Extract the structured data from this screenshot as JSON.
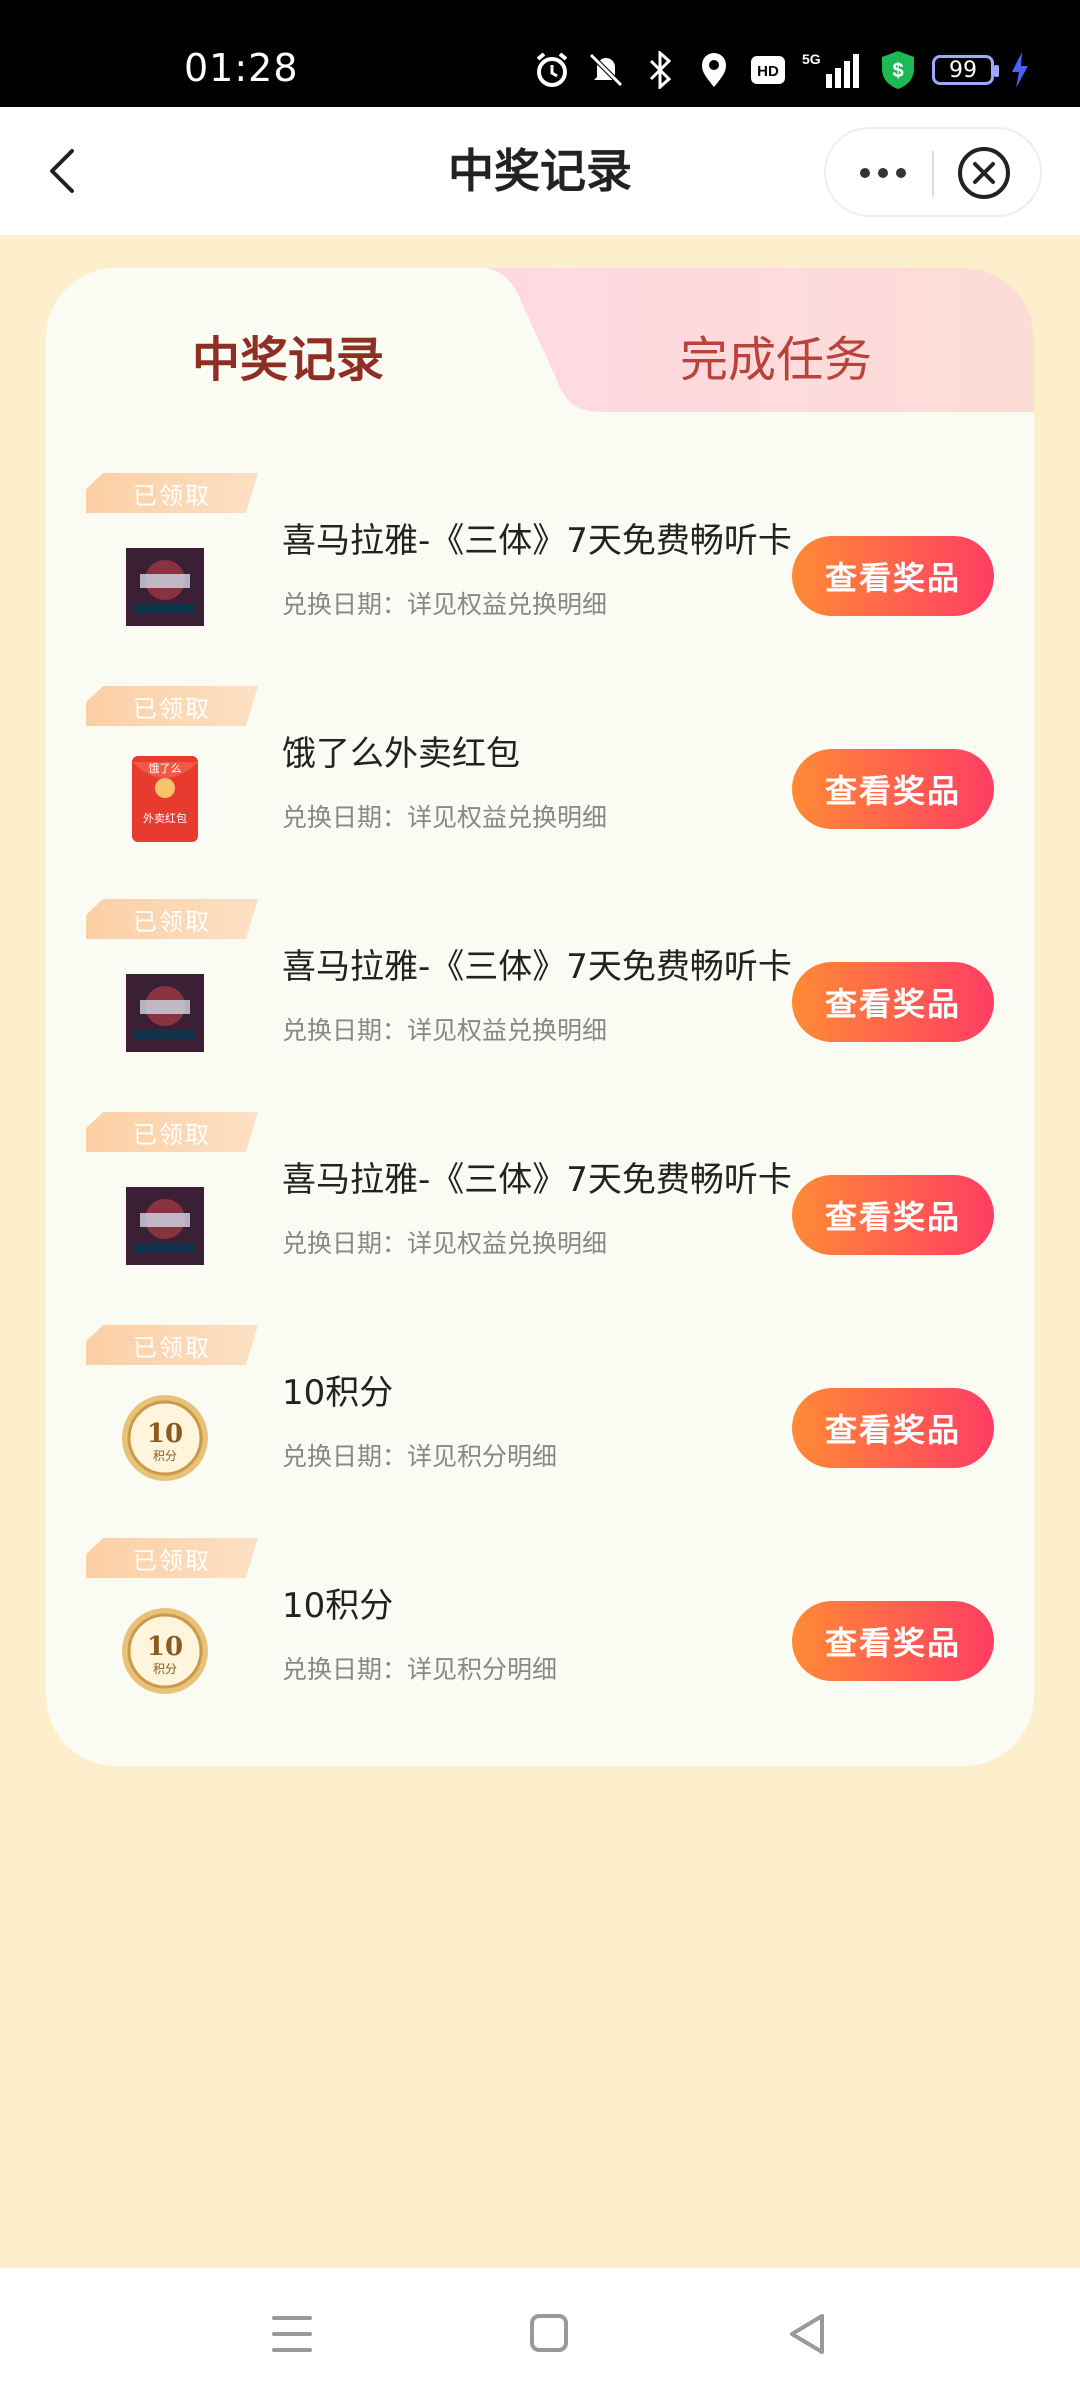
{
  "status_bar": {
    "time": "01:28",
    "network": "5G",
    "battery": "99",
    "icons": [
      "alarm-icon",
      "mute-icon",
      "bluetooth-icon",
      "location-icon",
      "hd-icon",
      "signal-icon",
      "shield-dollar-icon",
      "battery-icon",
      "charging-icon"
    ]
  },
  "header": {
    "title": "中奖记录",
    "back_icon": "chevron-left-icon",
    "more_icon": "more-icon",
    "close_icon": "close-circle-icon"
  },
  "tabs": [
    {
      "label": "中奖记录",
      "active": true
    },
    {
      "label": "完成任务",
      "active": false
    }
  ],
  "records": [
    {
      "status": "已领取",
      "title": "喜马拉雅-《三体》7天免费畅听卡",
      "subtitle": "兑换日期：详见权益兑换明细",
      "button": "查看奖品",
      "thumb": "book-cover"
    },
    {
      "status": "已领取",
      "title": "饿了么外卖红包",
      "subtitle": "兑换日期：详见权益兑换明细",
      "button": "查看奖品",
      "thumb": "red-envelope"
    },
    {
      "status": "已领取",
      "title": "喜马拉雅-《三体》7天免费畅听卡",
      "subtitle": "兑换日期：详见权益兑换明细",
      "button": "查看奖品",
      "thumb": "book-cover"
    },
    {
      "status": "已领取",
      "title": "喜马拉雅-《三体》7天免费畅听卡",
      "subtitle": "兑换日期：详见权益兑换明细",
      "button": "查看奖品",
      "thumb": "book-cover"
    },
    {
      "status": "已领取",
      "title": "10积分",
      "subtitle": "兑换日期：详见积分明细",
      "button": "查看奖品",
      "thumb": "points-coin"
    },
    {
      "status": "已领取",
      "title": "10积分",
      "subtitle": "兑换日期：详见积分明细",
      "button": "查看奖品",
      "thumb": "points-coin"
    }
  ],
  "red_envelope": {
    "brand": "饿了么",
    "label": "外卖红包"
  },
  "coin": {
    "value": "10",
    "label": "积分"
  },
  "navbar": {
    "icons": [
      "menu-icon",
      "home-square-icon",
      "back-triangle-icon"
    ]
  },
  "colors": {
    "page_bg": "#FDEFCB",
    "card_bg": "#FAFCF4",
    "tab_active": "#8F2E22",
    "tab_inactive": "#B9433B",
    "button_start": "#FF8A35",
    "button_end": "#FF3D63"
  }
}
